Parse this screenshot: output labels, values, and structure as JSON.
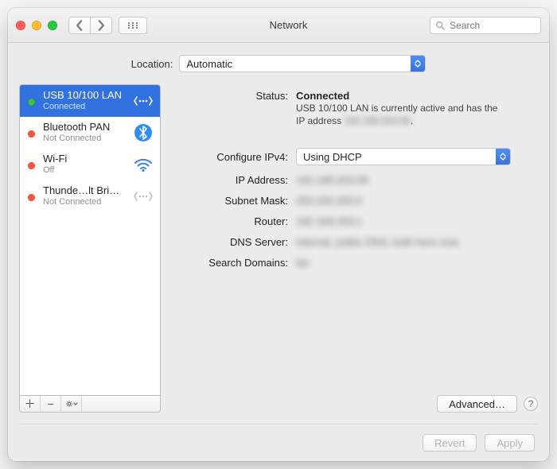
{
  "titlebar": {
    "title": "Network",
    "search_placeholder": "Search"
  },
  "location": {
    "label": "Location:",
    "value": "Automatic"
  },
  "sidebar": {
    "items": [
      {
        "name": "USB 10/100 LAN",
        "status_label": "Connected",
        "status": "green",
        "icon": "ethernet",
        "selected": true
      },
      {
        "name": "Bluetooth PAN",
        "status_label": "Not Connected",
        "status": "red",
        "icon": "bluetooth",
        "selected": false
      },
      {
        "name": "Wi-Fi",
        "status_label": "Off",
        "status": "red",
        "icon": "wifi",
        "selected": false
      },
      {
        "name": "Thunde…lt Bridge",
        "status_label": "Not Connected",
        "status": "red",
        "icon": "ethernet-off",
        "selected": false
      }
    ]
  },
  "detail": {
    "status_label": "Status:",
    "status_value": "Connected",
    "status_desc_line1": "USB 10/100 LAN is currently active and has the",
    "status_desc_line2_prefix": "IP address ",
    "status_desc_line2_blurred": "192.168.203.58",
    "status_desc_line2_suffix": ".",
    "configure_label": "Configure IPv4:",
    "configure_value": "Using DHCP",
    "rows": [
      {
        "label": "IP Address:",
        "value": "192.168.203.58"
      },
      {
        "label": "Subnet Mask:",
        "value": "255.255.255.0"
      },
      {
        "label": "Router:",
        "value": "192.168.203.1"
      },
      {
        "label": "DNS Server:",
        "value": "internal, public DNS, both here now"
      },
      {
        "label": "Search Domains:",
        "value": "lan"
      }
    ],
    "advanced_label": "Advanced…"
  },
  "footer": {
    "revert": "Revert",
    "apply": "Apply"
  }
}
